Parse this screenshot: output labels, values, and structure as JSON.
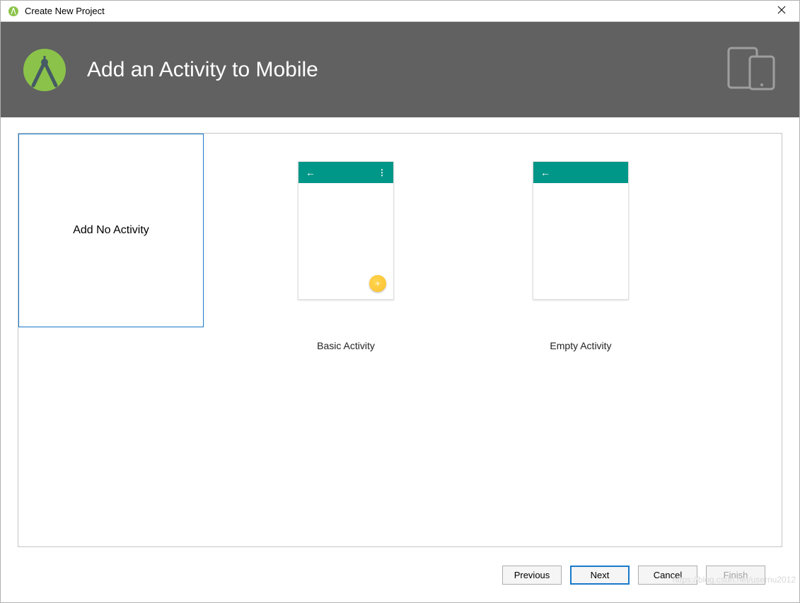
{
  "window": {
    "title": "Create New Project"
  },
  "banner": {
    "heading": "Add an Activity to Mobile"
  },
  "templates": [
    {
      "id": "no-activity",
      "label": "Add No Activity",
      "selected": true,
      "type": "blank"
    },
    {
      "id": "basic-activity",
      "label": "Basic Activity",
      "selected": false,
      "type": "basic"
    },
    {
      "id": "empty-activity",
      "label": "Empty Activity",
      "selected": false,
      "type": "empty"
    }
  ],
  "footer": {
    "previous": "Previous",
    "next": "Next",
    "cancel": "Cancel",
    "finish": "Finish"
  },
  "watermark": "https://blog.csdn.net/usernu2012"
}
